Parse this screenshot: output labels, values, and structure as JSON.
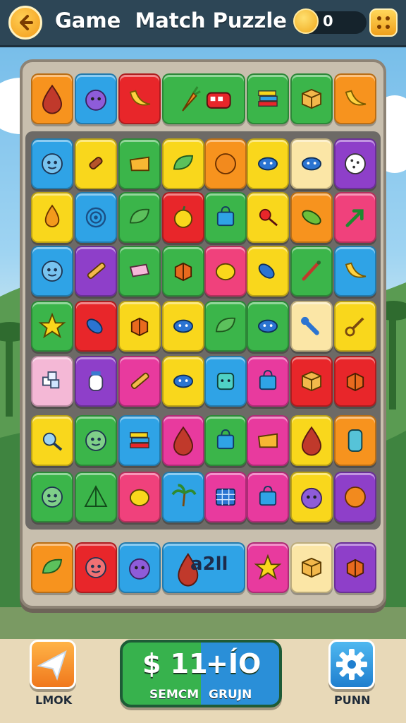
{
  "header": {
    "title": "Game  Match Puzzle",
    "coins": "0",
    "back_icon": "arrow-left-icon",
    "menu_icon": "grid-menu-icon",
    "coin_icon": "gold-coin-icon"
  },
  "board": {
    "top_row": [
      {
        "color": "#f7931e",
        "icon": "drop"
      },
      {
        "color": "#2fa3e6",
        "icon": "blob"
      },
      {
        "color": "#e8262a",
        "icon": "banana"
      },
      {
        "color": "#3bb54a",
        "icon": "carrot",
        "wide": true,
        "icon2": "bus"
      },
      {
        "color": "#3bb54a",
        "icon": "books"
      },
      {
        "color": "#3bb54a",
        "icon": "box"
      },
      {
        "color": "#f7931e",
        "icon": "banana"
      }
    ],
    "rows": [
      [
        {
          "color": "#2fa3e6",
          "icon": "face"
        },
        {
          "color": "#f9d71c",
          "icon": "bone"
        },
        {
          "color": "#3bb54a",
          "icon": "cheese"
        },
        {
          "color": "#f9d71c",
          "icon": "leaf"
        },
        {
          "color": "#f7931e",
          "icon": "circle"
        },
        {
          "color": "#f9d71c",
          "icon": "bug"
        },
        {
          "color": "#fbe6a6",
          "icon": "bug"
        },
        {
          "color": "#8e3fc9",
          "icon": "cookie"
        }
      ],
      [
        {
          "color": "#f9d71c",
          "icon": "flame"
        },
        {
          "color": "#2fa3e6",
          "icon": "spiral"
        },
        {
          "color": "#3bb54a",
          "icon": "leaf"
        },
        {
          "color": "#e8262a",
          "icon": "apple"
        },
        {
          "color": "#3bb54a",
          "icon": "bag"
        },
        {
          "color": "#f9d71c",
          "icon": "pin"
        },
        {
          "color": "#f7931e",
          "icon": "pickle"
        },
        {
          "color": "#f0417c",
          "icon": "arrow"
        }
      ],
      [
        {
          "color": "#2fa3e6",
          "icon": "face"
        },
        {
          "color": "#8e3fc9",
          "icon": "stick"
        },
        {
          "color": "#3bb54a",
          "icon": "eraser"
        },
        {
          "color": "#3bb54a",
          "icon": "cube"
        },
        {
          "color": "#f0417c",
          "icon": "lemon"
        },
        {
          "color": "#f9d71c",
          "icon": "fish"
        },
        {
          "color": "#3bb54a",
          "icon": "brush"
        },
        {
          "color": "#2fa3e6",
          "icon": "banana"
        }
      ],
      [
        {
          "color": "#3bb54a",
          "icon": "star"
        },
        {
          "color": "#e8262a",
          "icon": "fish"
        },
        {
          "color": "#f9d71c",
          "icon": "cube"
        },
        {
          "color": "#f9d71c",
          "icon": "bug"
        },
        {
          "color": "#3bb54a",
          "icon": "leaf"
        },
        {
          "color": "#3bb54a",
          "icon": "bug"
        },
        {
          "color": "#fbe6a6",
          "icon": "bat"
        },
        {
          "color": "#f9d71c",
          "icon": "key"
        }
      ],
      [
        {
          "color": "#f4b8d6",
          "icon": "cubes"
        },
        {
          "color": "#8e3fc9",
          "icon": "jar"
        },
        {
          "color": "#e83a9e",
          "icon": "stick"
        },
        {
          "color": "#f9d71c",
          "icon": "bug"
        },
        {
          "color": "#2fa3e6",
          "icon": "cup"
        },
        {
          "color": "#e83a9e",
          "icon": "bag"
        },
        {
          "color": "#e8262a",
          "icon": "box"
        },
        {
          "color": "#e8262a",
          "icon": "cube"
        }
      ],
      [
        {
          "color": "#f9d71c",
          "icon": "magnifier"
        },
        {
          "color": "#3bb54a",
          "icon": "face"
        },
        {
          "color": "#2fa3e6",
          "icon": "books"
        },
        {
          "color": "#e83a9e",
          "icon": "drop"
        },
        {
          "color": "#3bb54a",
          "icon": "bag"
        },
        {
          "color": "#e83a9e",
          "icon": "cheese"
        },
        {
          "color": "#f9d71c",
          "icon": "drop"
        },
        {
          "color": "#f7931e",
          "icon": "phone"
        }
      ],
      [
        {
          "color": "#3bb54a",
          "icon": "face"
        },
        {
          "color": "#3bb54a",
          "icon": "tent"
        },
        {
          "color": "#f0417c",
          "icon": "lemon"
        },
        {
          "color": "#2fa3e6",
          "icon": "palm"
        },
        {
          "color": "#e83a9e",
          "icon": "grid"
        },
        {
          "color": "#e83a9e",
          "icon": "bag"
        },
        {
          "color": "#f9d71c",
          "icon": "blob"
        },
        {
          "color": "#8e3fc9",
          "icon": "circle"
        }
      ]
    ],
    "bottom_row": [
      {
        "color": "#f7931e",
        "icon": "leaf"
      },
      {
        "color": "#e8262a",
        "icon": "face"
      },
      {
        "color": "#2fa3e6",
        "icon": "blob"
      },
      {
        "color": "#2fa3e6",
        "icon": "drop",
        "wide": true,
        "label": "a2ll"
      },
      {
        "color": "#e83a9e",
        "icon": "star"
      },
      {
        "color": "#fbe6a6",
        "icon": "box"
      },
      {
        "color": "#8e3fc9",
        "icon": "cube"
      }
    ]
  },
  "footer": {
    "left_button": {
      "label": "LMOK",
      "icon": "paper-plane-icon"
    },
    "score": {
      "left_value": "$ 11",
      "right_value": "+ÍO",
      "left_label": "SEMCM",
      "right_label": "GRUJN"
    },
    "right_button": {
      "label": "PUNN",
      "icon": "gear-icon"
    }
  }
}
